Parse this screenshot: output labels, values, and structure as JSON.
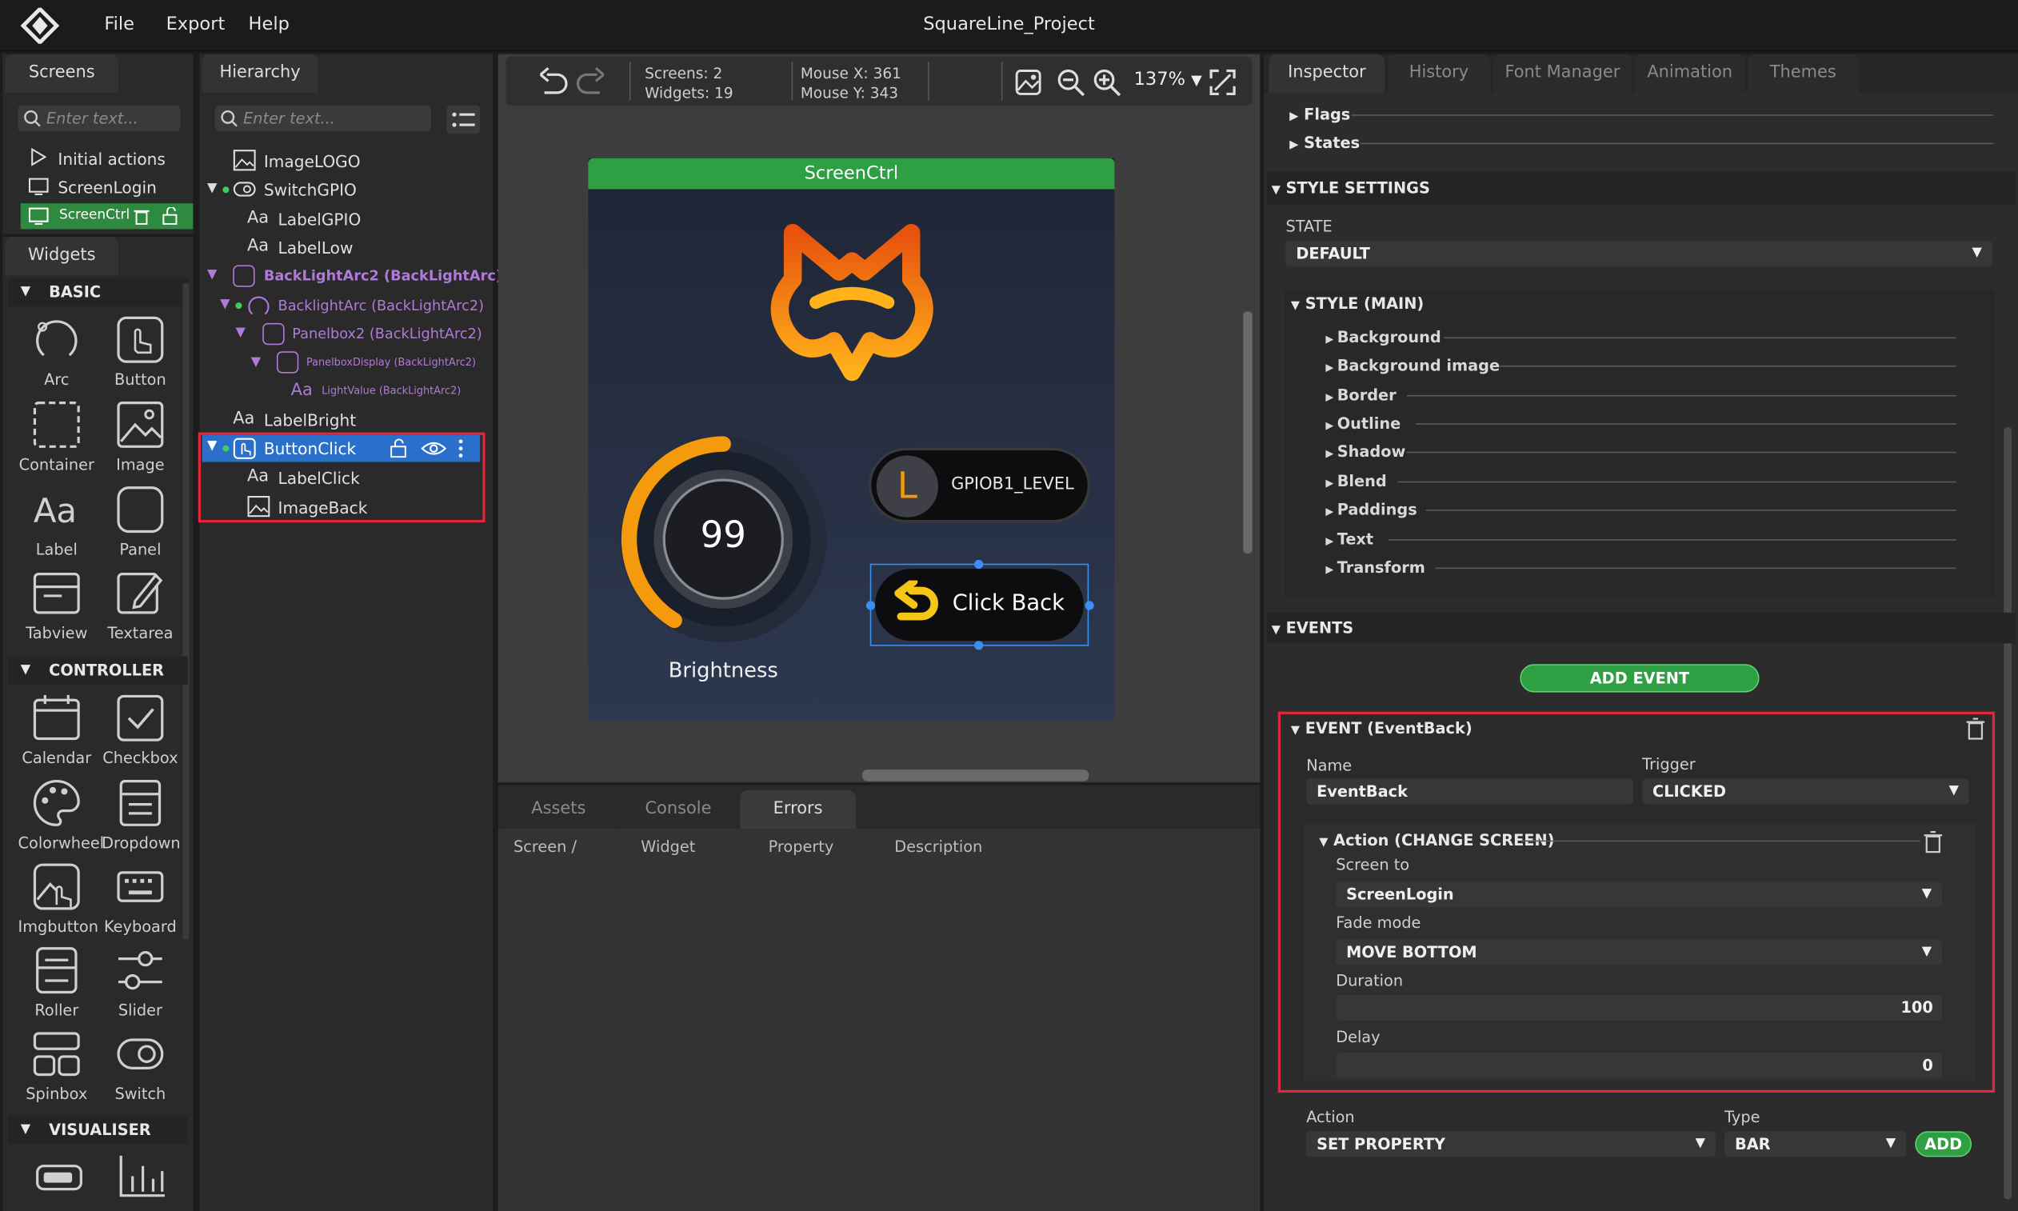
{
  "app": {
    "title": "SquareLine_Project"
  },
  "menu": {
    "file": "File",
    "export": "Export",
    "help": "Help"
  },
  "screens_panel": {
    "tab": "Screens",
    "search_placeholder": "Enter text...",
    "items": [
      "Initial actions",
      "ScreenLogin",
      "ScreenCtrl"
    ]
  },
  "widgets_panel": {
    "tab": "Widgets",
    "sections": {
      "basic": "BASIC",
      "controller": "CONTROLLER",
      "visualiser": "VISUALISER"
    },
    "basic": [
      "Arc",
      "Button",
      "Container",
      "Image",
      "Label",
      "Panel",
      "Tabview",
      "Textarea"
    ],
    "controller": [
      "Calendar",
      "Checkbox",
      "Colorwheel",
      "Dropdown",
      "Imgbutton",
      "Keyboard",
      "Roller",
      "Slider",
      "Spinbox",
      "Switch"
    ]
  },
  "hierarchy": {
    "tab": "Hierarchy",
    "search_placeholder": "Enter text...",
    "items": [
      "ImageLOGO",
      "SwitchGPIO",
      "LabelGPIO",
      "LabelLow",
      "BackLightArc2 (BackLightArc)",
      "BacklightArc (BackLightArc2)",
      "Panelbox2 (BackLightArc2)",
      "PanelboxDisplay (BackLightArc2)",
      "LightValue (BackLightArc2)",
      "LabelBright",
      "ButtonClick",
      "LabelClick",
      "ImageBack"
    ]
  },
  "toolbar": {
    "screens_label": "Screens:",
    "screens_value": "2",
    "widgets_label": "Widgets:",
    "widgets_value": "19",
    "mousex_label": "Mouse X:",
    "mousex_value": "361",
    "mousey_label": "Mouse Y:",
    "mousey_value": "343",
    "zoom": "137%"
  },
  "canvas": {
    "screen_name": "ScreenCtrl",
    "arc_value": "99",
    "arc_label": "Brightness",
    "switch_letter": "L",
    "switch_label": "GPIOB1_LEVEL",
    "button_label": "Click Back",
    "colors": {
      "header": "#2ea043",
      "arc": "#f59a0c",
      "screen_bg": "#2a3448"
    }
  },
  "bottom_panel": {
    "tabs": [
      "Assets",
      "Console",
      "Errors"
    ],
    "columns": [
      "Screen /",
      "Widget",
      "Property",
      "Description"
    ]
  },
  "inspector": {
    "tabs": [
      "Inspector",
      "History",
      "Font Manager",
      "Animation",
      "Themes"
    ],
    "flags": "Flags",
    "states": "States",
    "style_settings": "STYLE SETTINGS",
    "state_label": "STATE",
    "state_value": "DEFAULT",
    "style_main": "STYLE (MAIN)",
    "style_items": [
      "Background",
      "Background image",
      "Border",
      "Outline",
      "Shadow",
      "Blend",
      "Paddings",
      "Text",
      "Transform"
    ],
    "events": "EVENTS",
    "add_event": "ADD EVENT",
    "event": {
      "title": "EVENT (EventBack)",
      "name_label": "Name",
      "name_value": "EventBack",
      "trigger_label": "Trigger",
      "trigger_value": "CLICKED",
      "action_title": "Action (CHANGE SCREEN)",
      "screen_to_label": "Screen to",
      "screen_to_value": "ScreenLogin",
      "fade_label": "Fade mode",
      "fade_value": "MOVE BOTTOM",
      "duration_label": "Duration",
      "duration_value": "100",
      "delay_label": "Delay",
      "delay_value": "0"
    },
    "action_label": "Action",
    "action_value": "SET PROPERTY",
    "type_label": "Type",
    "type_value": "BAR",
    "add": "ADD"
  }
}
